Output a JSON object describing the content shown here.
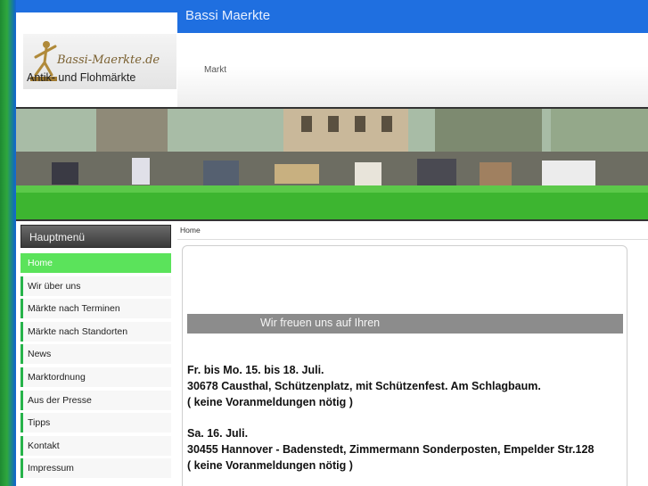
{
  "header": {
    "site_title": "Bassi Maerkte",
    "logo_script": "Bassi-Maerkte.de",
    "logo_subtitle": "Antik- und Flohmärkte",
    "nav": {
      "markt": "Markt"
    }
  },
  "sidebar": {
    "title": "Hauptmenü",
    "items": [
      {
        "label": "Home"
      },
      {
        "label": "Wir über uns"
      },
      {
        "label": "Märkte nach Terminen"
      },
      {
        "label": "Märkte nach Standorten"
      },
      {
        "label": "News"
      },
      {
        "label": "Marktordnung"
      },
      {
        "label": "Aus der Presse"
      },
      {
        "label": "Tipps"
      },
      {
        "label": "Kontakt"
      },
      {
        "label": "Impressum"
      }
    ]
  },
  "main": {
    "breadcrumb": "Home",
    "welcome": "Wir freuen uns auf Ihren",
    "events": [
      {
        "date": "Fr. bis Mo. 15. bis 18. Juli.",
        "location": "30678 Causthal, Schützenplatz, mit Schützenfest. Am Schlagbaum.",
        "note": "( keine Voranmeldungen nötig )"
      },
      {
        "date": "Sa. 16. Juli.",
        "location": "30455 Hannover - Badenstedt, Zimmermann Sonderposten, Empelder Str.128",
        "note": "( keine Voranmeldungen nötig )"
      }
    ]
  },
  "colors": {
    "accent_blue": "#1f6fe0",
    "menu_active": "#5be35b",
    "menu_border": "#27b34a",
    "welcome_bar": "#8c8c8c"
  }
}
